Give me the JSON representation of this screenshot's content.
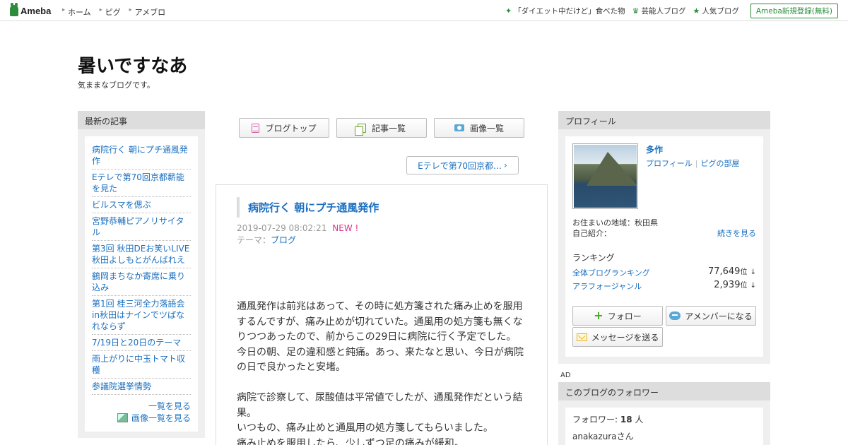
{
  "topbar": {
    "logo": "Ameba",
    "nav": [
      "ホーム",
      "ピグ",
      "アメブロ"
    ],
    "links": [
      {
        "icon": "sparkle-icon",
        "label": "「ダイエット中だけど」食べた物"
      },
      {
        "icon": "crown-icon",
        "label": "芸能人ブログ"
      },
      {
        "icon": "star-icon",
        "label": "人気ブログ"
      }
    ],
    "signup": "Ameba新規登録(無料)"
  },
  "blog": {
    "title": "暑いですなあ",
    "description": "気ままなブログです。"
  },
  "recent": {
    "heading": "最新の記事",
    "items": [
      "病院行く 朝にプチ通風発作",
      "Eテレで第70回京都薪能を見た",
      "ビルスマを偲ぶ",
      "宮野恭輔ピアノリサイタル",
      "第3回 秋田DEお笑いLIVE 秋田よしもとがんばれえ",
      "鶴岡まちなか寄席に乗り込み",
      "第1回 桂三河全力落語会in秋田はナインでツぱなれならず",
      "7/19日と20日のテーマ",
      "雨上がりに中玉トマト収穫",
      "参議院選挙情勢"
    ],
    "see_all": "一覧を見る",
    "image_list": "画像一覧を見る"
  },
  "nav_buttons": {
    "top": "ブログトップ",
    "articles": "記事一覧",
    "images": "画像一覧"
  },
  "next_article": "Eテレで第70回京都…",
  "article": {
    "title": "病院行く 朝にプチ通風発作",
    "datetime": "2019-07-29 08:02:21",
    "new": "NEW !",
    "theme_label": "テーマ：",
    "theme": "ブログ",
    "body": [
      "通風発作は前兆はあって、その時に処方箋された痛み止めを服用するんですが、痛み止めが切れていた。通風用の処方箋も無くなりつつあったので、前からこの29日に病院に行く予定でした。",
      "今日の朝、足の違和感と鈍痛。あっ、来たなと思い、今日が病院の日で良かったと安堵。",
      "",
      "病院で診察して、尿酸値は平常値でしたが、通風発作だという結果。",
      "いつもの、痛み止めと通風用の処方箋してもらいました。",
      "痛み止めを服用したら、少しずつ足の痛みが緩和。"
    ]
  },
  "profile": {
    "heading": "プロフィール",
    "name": "多作",
    "link_profile": "プロフィール",
    "link_pig": "ピグの部屋",
    "location_label": "お住まいの地域：秋田県",
    "intro_label": "自己紹介：",
    "continue": "続きを見る",
    "ranking_title": "ランキング",
    "rankings": [
      {
        "label": "全体ブログランキング",
        "value": "77,649",
        "unit": "位",
        "trend": "↓"
      },
      {
        "label": "アラフォージャンル",
        "value": "2,939",
        "unit": "位",
        "trend": "↓"
      }
    ],
    "follow": "フォロー",
    "member": "アメンバーになる",
    "message": "メッセージを送る"
  },
  "ad_label": "AD",
  "followers": {
    "heading": "このブログのフォロワー",
    "count_label": "フォロワー: ",
    "count": "18",
    "count_unit": " 人",
    "first": "anakazuraさん"
  }
}
